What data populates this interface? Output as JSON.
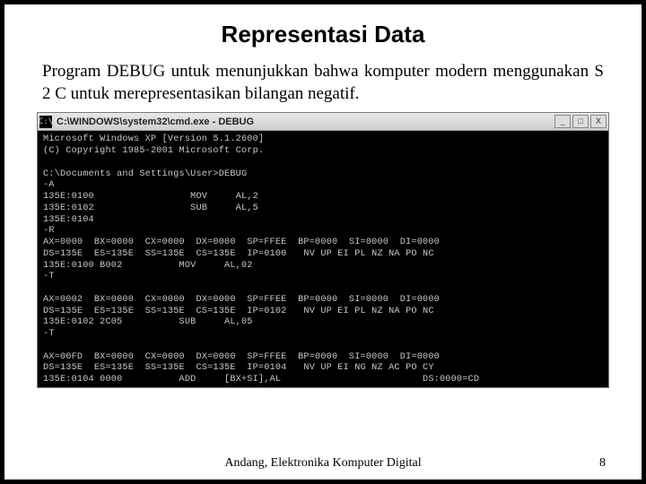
{
  "title": "Representasi Data",
  "body": "Program DEBUG untuk menunjukkan bahwa komputer modern menggunakan S 2 C untuk merepresentasikan bilangan negatif.",
  "cmd": {
    "icon": "C:\\",
    "title": "C:\\WINDOWS\\system32\\cmd.exe - DEBUG",
    "btn_min": "_",
    "btn_max": "□",
    "btn_close": "X",
    "content": "Microsoft Windows XP [Version 5.1.2600]\n(C) Copyright 1985-2001 Microsoft Corp.\n\nC:\\Documents and Settings\\User>DEBUG\n-A\n135E:0100                 MOV     AL,2\n135E:0102                 SUB     AL,5\n135E:0104\n-R\nAX=0000  BX=0000  CX=0000  DX=0000  SP=FFEE  BP=0000  SI=0000  DI=0000\nDS=135E  ES=135E  SS=135E  CS=135E  IP=0100   NV UP EI PL NZ NA PO NC\n135E:0100 B002          MOV     AL,02\n-T\n\nAX=0002  BX=0000  CX=0000  DX=0000  SP=FFEE  BP=0000  SI=0000  DI=0000\nDS=135E  ES=135E  SS=135E  CS=135E  IP=0102   NV UP EI PL NZ NA PO NC\n135E:0102 2C05          SUB     AL,05\n-T\n\nAX=00FD  BX=0000  CX=0000  DX=0000  SP=FFEE  BP=0000  SI=0000  DI=0000\nDS=135E  ES=135E  SS=135E  CS=135E  IP=0104   NV UP EI NG NZ AC PO CY\n135E:0104 0000          ADD     [BX+SI],AL                         DS:0000=CD\n-"
  },
  "footer": {
    "center": "Andang, Elektronika Komputer Digital",
    "page": "8"
  }
}
